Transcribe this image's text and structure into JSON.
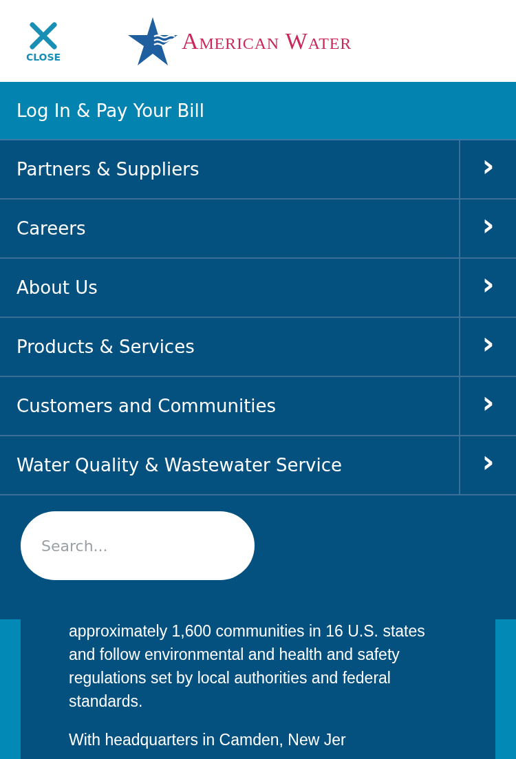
{
  "header": {
    "close_label": "CLOSE",
    "logo_text": "American Water"
  },
  "primary_link": "Log In & Pay Your Bill",
  "menu_items": [
    {
      "label": "Partners & Suppliers",
      "chevron": "›"
    },
    {
      "label": "Careers",
      "chevron": "›"
    },
    {
      "label": "About Us",
      "chevron": "›"
    },
    {
      "label": "Products & Services",
      "chevron": "›"
    },
    {
      "label": "Customers and Communities",
      "chevron": "›"
    },
    {
      "label": "Water Quality & Wastewater Service",
      "chevron": "›"
    }
  ],
  "search": {
    "placeholder": "Search..."
  },
  "body_text": [
    "approximately 1,600 communities in 16 U.S. states and follow environmental and health and safety regulations set by local authorities and federal standards.",
    "With headquarters in Camden, New Jer"
  ]
}
